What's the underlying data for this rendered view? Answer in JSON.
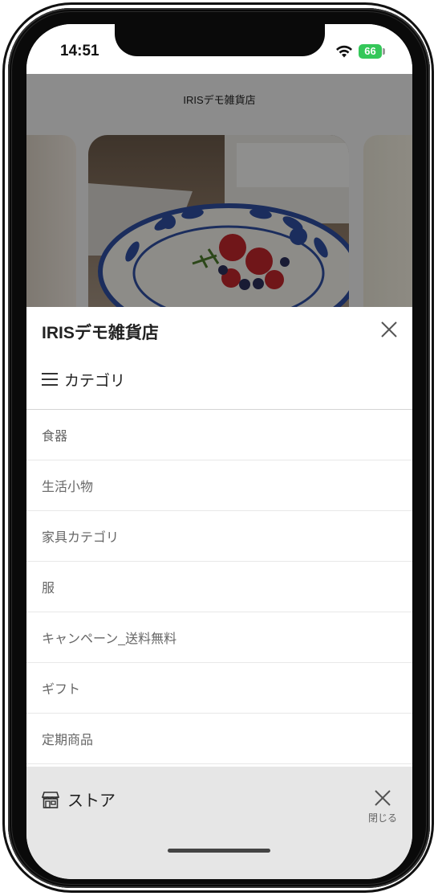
{
  "status_bar": {
    "time": "14:51",
    "battery": "66"
  },
  "background_page": {
    "title": "IRISデモ雑貨店"
  },
  "drawer": {
    "title": "IRISデモ雑貨店",
    "category_header": "カテゴリ",
    "categories": [
      "食器",
      "生活小物",
      "家具カテゴリ",
      "服",
      "キャンペーン_送料無料",
      "ギフト",
      "定期商品"
    ]
  },
  "bottom_bar": {
    "store_label": "ストア",
    "close_label": "閉じる"
  },
  "colors": {
    "battery": "#34c759",
    "overlay": "rgba(0,0,0,0.42)",
    "bottom_bar": "#e6e6e6"
  }
}
